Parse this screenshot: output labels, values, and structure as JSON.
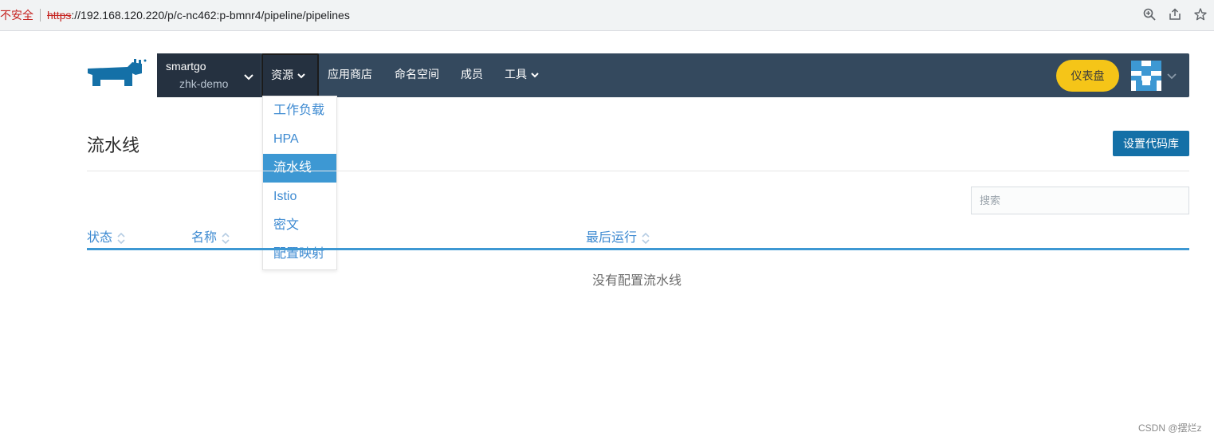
{
  "browser": {
    "security_label": "不安全",
    "url_protocol": "https",
    "url_rest": "://192.168.120.220/p/c-nc462:p-bmnr4/pipeline/pipelines",
    "icons": [
      "zoom-icon",
      "share-icon",
      "star-icon"
    ]
  },
  "nav": {
    "project_name": "smartgo",
    "project_sub": "zhk-demo",
    "items": [
      {
        "label": "资源"
      },
      {
        "label": "应用商店"
      },
      {
        "label": "命名空间"
      },
      {
        "label": "成员"
      },
      {
        "label": "工具"
      }
    ],
    "dashboard_label": "仪表盘"
  },
  "dropdown": {
    "items": [
      {
        "label": "工作负载"
      },
      {
        "label": "HPA"
      },
      {
        "label": "流水线"
      },
      {
        "label": "Istio"
      },
      {
        "label": "密文"
      },
      {
        "label": "配置映射"
      }
    ],
    "active_index": 2
  },
  "page": {
    "title": "流水线",
    "repo_button": "设置代码库",
    "search_placeholder": "搜索"
  },
  "table": {
    "columns": [
      {
        "label": "状态"
      },
      {
        "label": "名称"
      },
      {
        "label": "最后运行"
      }
    ],
    "empty_text": "没有配置流水线"
  },
  "watermark": "CSDN @摆烂z",
  "colors": {
    "nav_bg": "#34495e",
    "nav_dark": "#253140",
    "accent": "#3d98d3",
    "link": "#3d8ad1",
    "primary_button": "#1470a7",
    "dashboard_button": "#f5c518",
    "logo": "#1470a7"
  }
}
